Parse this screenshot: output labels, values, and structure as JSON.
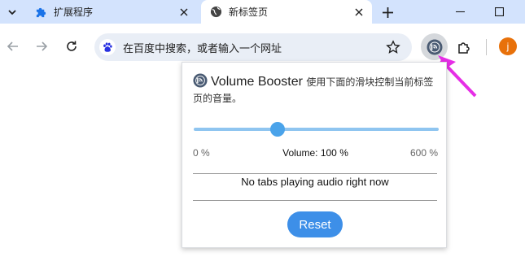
{
  "tabs": [
    {
      "label": "扩展程序",
      "icon": "puzzle-icon"
    },
    {
      "label": "新标签页",
      "icon": "globe-icon"
    }
  ],
  "omnibox": {
    "placeholder": "在百度中搜索，或者输入一个网址",
    "engine_icon": "baidu-paw-icon"
  },
  "profile": {
    "initial": "j"
  },
  "popup": {
    "name": "Volume Booster",
    "description": "使用下面的滑块控制当前标签页的音量。",
    "slider": {
      "min_label": "0 %",
      "max_label": "600 %",
      "current_label": "Volume: 100 %",
      "value_percent": 100,
      "min": 0,
      "max": 600
    },
    "status": "No tabs playing audio right now",
    "reset_label": "Reset"
  },
  "colors": {
    "tabbar": "#d3e3fd",
    "accent": "#3d8fe8",
    "slider_track": "#8fc5f0",
    "pointer": "#e62ee6",
    "avatar": "#e8710a"
  }
}
